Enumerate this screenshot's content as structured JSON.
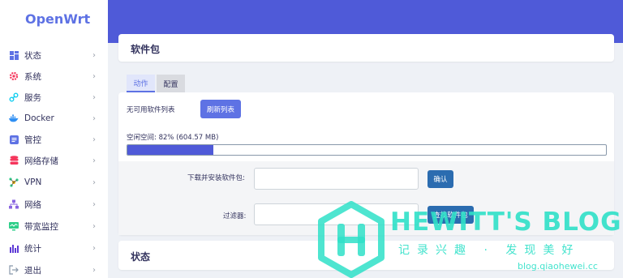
{
  "brand": "OpenWrt",
  "sidebar": {
    "items": [
      {
        "label": "状态",
        "icon": "dashboard-icon"
      },
      {
        "label": "系统",
        "icon": "gear-icon"
      },
      {
        "label": "服务",
        "icon": "link-icon"
      },
      {
        "label": "Docker",
        "icon": "docker-whale-icon"
      },
      {
        "label": "管控",
        "icon": "control-panel-icon"
      },
      {
        "label": "网络存储",
        "icon": "database-icon"
      },
      {
        "label": "VPN",
        "icon": "vpn-icon"
      },
      {
        "label": "网络",
        "icon": "network-icon"
      },
      {
        "label": "带宽监控",
        "icon": "monitor-icon"
      },
      {
        "label": "统计",
        "icon": "bar-chart-icon"
      },
      {
        "label": "退出",
        "icon": "logout-icon"
      }
    ],
    "chevron": "›"
  },
  "main": {
    "title": "软件包",
    "tabs": [
      {
        "label": "动作",
        "active": true
      },
      {
        "label": "配置",
        "active": false
      }
    ],
    "no_list_text": "无可用软件列表",
    "refresh_label": "刷新列表",
    "free_space_label": "空闲空间: 82% (604.57 MB)",
    "free_space_fraction": 0.18,
    "download_label": "下载并安装软件包:",
    "download_value": "",
    "confirm_label": "确认",
    "filter_label": "过滤器:",
    "filter_value": "",
    "find_label": "查找软件包"
  },
  "status_section": {
    "title": "状态"
  },
  "watermark": {
    "title": "HEWITT'S BLOG",
    "subtitle": "记录兴趣 · 发现美好",
    "url": "blog.qiaohewei.cc"
  },
  "colors": {
    "accent": "#5e72e4",
    "header": "#4f5ad8",
    "watermark": "#2fe0c8"
  }
}
